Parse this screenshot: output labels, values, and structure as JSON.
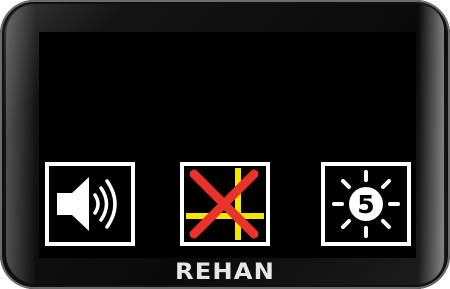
{
  "device": {
    "brand": "REHAN"
  },
  "controls": [
    {
      "id": "volume",
      "icon": "speaker-volume-icon"
    },
    {
      "id": "overlay",
      "icon": "crosshair-disabled-icon"
    },
    {
      "id": "brightness",
      "icon": "brightness-icon",
      "level": "5"
    }
  ],
  "colors": {
    "screen": "#000000",
    "tile_border": "#ffffff",
    "crosshair": "#f5e600",
    "cross_out": "#e8322a"
  }
}
